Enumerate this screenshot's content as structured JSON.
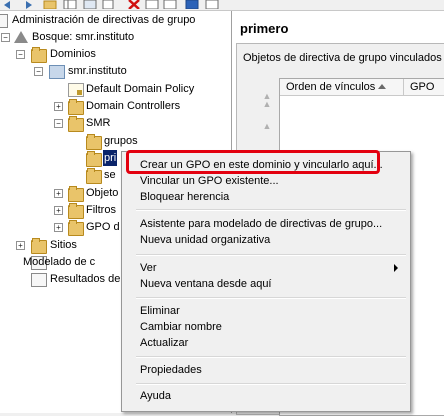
{
  "tree": {
    "root": "Administración de directivas de grupo",
    "forest": "Bosque: smr.instituto",
    "domains": "Dominios",
    "domain": "smr.instituto",
    "default_policy": "Default Domain Policy",
    "domain_controllers": "Domain Controllers",
    "smr": "SMR",
    "grupos": "grupos",
    "primero_partial": "pri",
    "segundo_partial": "se",
    "objetos_partial": "Objeto",
    "filtros_partial": "Filtros",
    "gpo_partial": "GPO d",
    "sitios": "Sitios",
    "modelado_partial": "Modelado de c",
    "resultados_partial": "Resultados de"
  },
  "right": {
    "title": "primero",
    "panel_label": "Objetos de directiva de grupo vinculados",
    "columns": [
      "Orden de vínculos",
      "GPO"
    ]
  },
  "menu": {
    "items": [
      "Crear un GPO en este dominio y vincularlo aquí...",
      "Vincular un GPO existente...",
      "Bloquear herencia",
      "Asistente para modelado de directivas de grupo...",
      "Nueva unidad organizativa",
      "Ver",
      "Nueva ventana desde aquí",
      "Eliminar",
      "Cambiar nombre",
      "Actualizar",
      "Propiedades",
      "Ayuda"
    ]
  },
  "colors": {
    "highlight": "#e3000f",
    "selection": "#0a246a"
  }
}
